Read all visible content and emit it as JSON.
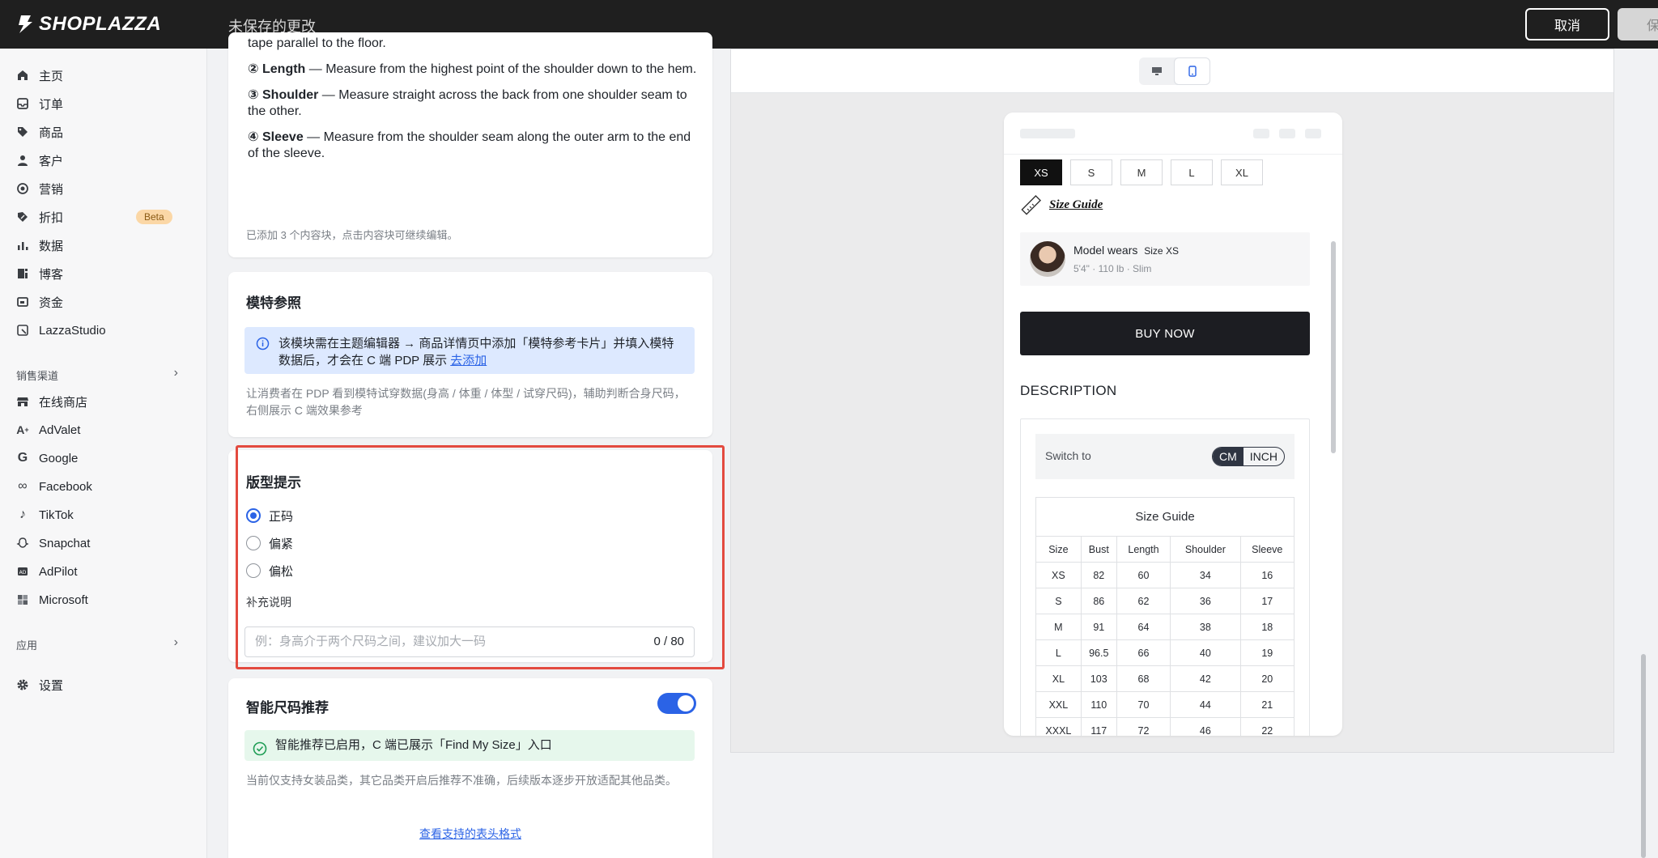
{
  "topbar": {
    "logo_text": "SHOPLAZZA",
    "unsaved_text": "未保存的更改",
    "cancel_label": "取消",
    "save_label": "保存"
  },
  "sidebar": {
    "items": [
      {
        "label": "主页",
        "icon": "home-icon"
      },
      {
        "label": "订单",
        "icon": "inbox-icon"
      },
      {
        "label": "商品",
        "icon": "tag-icon"
      },
      {
        "label": "客户",
        "icon": "person-icon"
      },
      {
        "label": "营销",
        "icon": "target-icon"
      },
      {
        "label": "折扣",
        "icon": "discount-icon",
        "badge": "Beta"
      },
      {
        "label": "数据",
        "icon": "bar-chart-icon"
      },
      {
        "label": "博客",
        "icon": "blog-icon"
      },
      {
        "label": "资金",
        "icon": "wallet-icon"
      },
      {
        "label": "LazzaStudio",
        "icon": "studio-icon"
      }
    ],
    "section_channels": "销售渠道",
    "channels": [
      {
        "label": "在线商店",
        "icon": "store-icon"
      },
      {
        "label": "AdValet",
        "icon": "advalet-icon"
      },
      {
        "label": "Google",
        "icon": "google-icon"
      },
      {
        "label": "Facebook",
        "icon": "meta-icon"
      },
      {
        "label": "TikTok",
        "icon": "tiktok-icon"
      },
      {
        "label": "Snapchat",
        "icon": "snapchat-icon"
      },
      {
        "label": "AdPilot",
        "icon": "adpilot-icon"
      },
      {
        "label": "Microsoft",
        "icon": "microsoft-icon"
      }
    ],
    "section_apps": "应用",
    "settings_label": "设置"
  },
  "measure_card": {
    "cut_text": "tape parallel to the floor.",
    "items": [
      {
        "num": "②",
        "name": "Length",
        "desc": " — Measure from the highest point of the shoulder down to the hem."
      },
      {
        "num": "③",
        "name": "Shoulder",
        "desc": " — Measure straight across the back from one shoulder seam to the other."
      },
      {
        "num": "④",
        "name": "Sleeve",
        "desc": " — Measure from the shoulder seam along the outer arm to the end of the sleeve."
      }
    ],
    "footnote": "已添加 3 个内容块，点击内容块可继续编辑。"
  },
  "model_card": {
    "title": "模特参照",
    "info_text": "该模块需在主题编辑器 → 商品详情页中添加「模特参考卡片」并填入模特数据后，才会在 C 端 PDP 展示",
    "info_link": "去添加",
    "desc": "让消费者在 PDP 看到模特试穿数据(身高 / 体重 / 体型 / 试穿尺码)，辅助判断合身尺码，右侧展示 C 端效果参考"
  },
  "fit_card": {
    "title": "版型提示",
    "options": [
      "正码",
      "偏紧",
      "偏松"
    ],
    "selected": "正码",
    "note_label": "补充说明",
    "note_placeholder": "例：身高介于两个尺码之间，建议加大一码",
    "note_counter": "0 / 80"
  },
  "smart_card": {
    "title": "智能尺码推荐",
    "toggle_on": true,
    "success_text": "智能推荐已启用，C 端已展示「Find My Size」入口",
    "desc": "当前仅支持女装品类，其它品类开启后推荐不准确，后续版本逐步开放适配其他品类。",
    "link": "查看支持的表头格式"
  },
  "preview": {
    "device_desktop_icon": "desktop-icon",
    "device_mobile_icon": "mobile-icon",
    "sizes": [
      "XS",
      "S",
      "M",
      "L",
      "XL"
    ],
    "selected_size": "XS",
    "size_guide_link": "Size Guide",
    "model_wears": "Model wears",
    "model_size": "Size XS",
    "model_stats": "5'4\" · 110 lb · Slim",
    "buy_now": "BUY NOW",
    "description_title": "DESCRIPTION",
    "switch_to": "Switch to",
    "unit_cm": "CM",
    "unit_inch": "INCH",
    "table_caption": "Size Guide",
    "table_headers": [
      "Size",
      "Bust",
      "Length",
      "Shoulder",
      "Sleeve"
    ],
    "table_rows": [
      [
        "XS",
        "82",
        "60",
        "34",
        "16"
      ],
      [
        "S",
        "86",
        "62",
        "36",
        "17"
      ],
      [
        "M",
        "91",
        "64",
        "38",
        "18"
      ],
      [
        "L",
        "96.5",
        "66",
        "40",
        "19"
      ],
      [
        "XL",
        "103",
        "68",
        "42",
        "20"
      ],
      [
        "XXL",
        "110",
        "70",
        "44",
        "21"
      ],
      [
        "XXXL",
        "117",
        "72",
        "46",
        "22"
      ]
    ]
  },
  "colors": {
    "accent": "#2b63e6",
    "highlight": "#e34a3f",
    "topbar": "#1f1f1f"
  }
}
